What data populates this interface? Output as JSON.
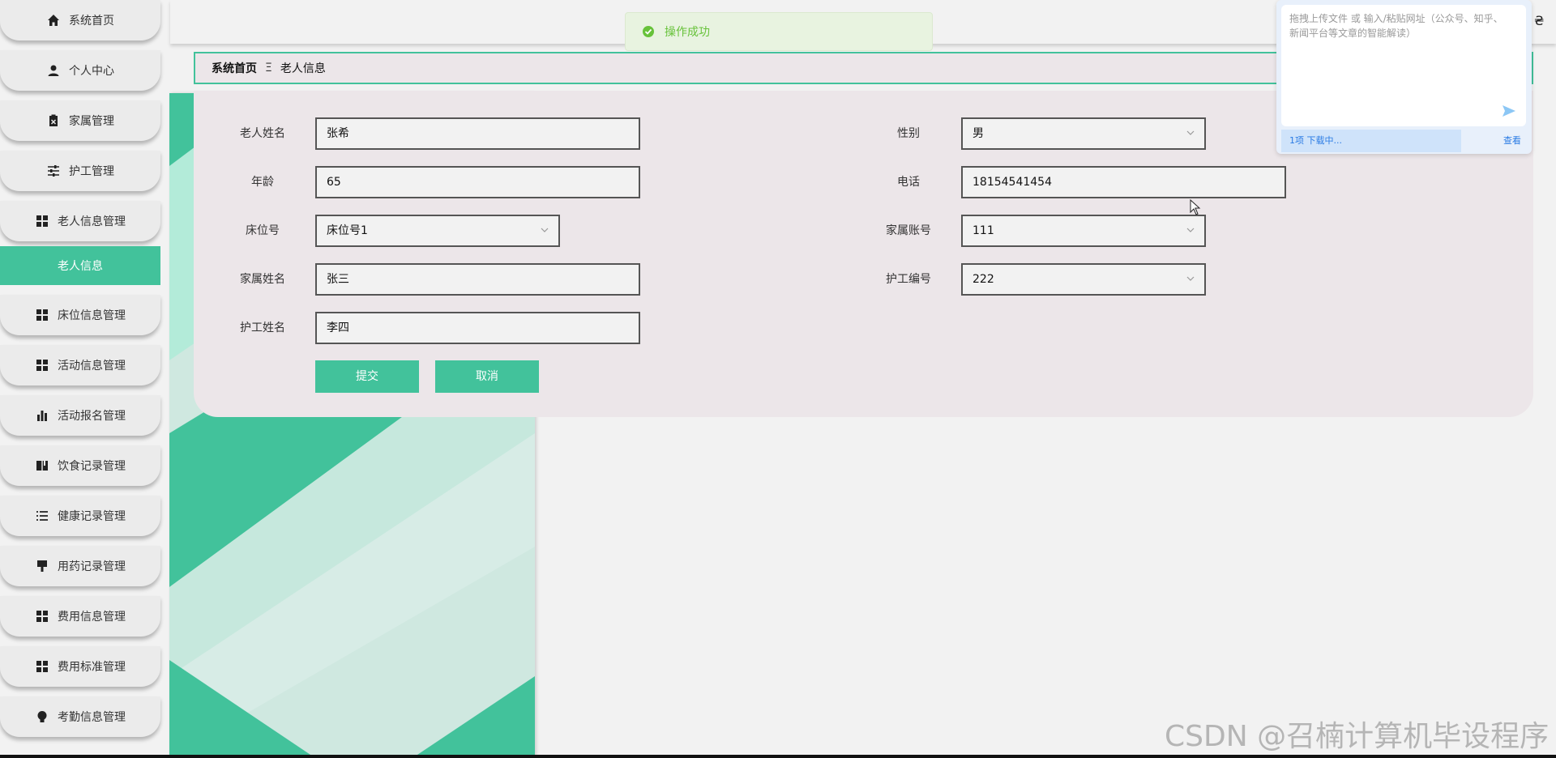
{
  "sidebar": {
    "items": [
      {
        "label": "系统首页",
        "icon": "home-icon"
      },
      {
        "label": "个人中心",
        "icon": "user-icon"
      },
      {
        "label": "家属管理",
        "icon": "clipboard-icon"
      },
      {
        "label": "护工管理",
        "icon": "sliders-icon"
      },
      {
        "label": "老人信息管理",
        "icon": "grid-icon"
      },
      {
        "label": "老人信息",
        "icon": "",
        "active": true
      },
      {
        "label": "床位信息管理",
        "icon": "grid-icon"
      },
      {
        "label": "活动信息管理",
        "icon": "grid-icon"
      },
      {
        "label": "活动报名管理",
        "icon": "bar-chart-icon"
      },
      {
        "label": "饮食记录管理",
        "icon": "book-icon"
      },
      {
        "label": "健康记录管理",
        "icon": "list-icon"
      },
      {
        "label": "用药记录管理",
        "icon": "brush-icon"
      },
      {
        "label": "费用信息管理",
        "icon": "grid-icon"
      },
      {
        "label": "费用标准管理",
        "icon": "grid-icon"
      },
      {
        "label": "考勤信息管理",
        "icon": "bulb-icon"
      }
    ]
  },
  "toast": {
    "message": "操作成功"
  },
  "breadcrumb": {
    "home": "系统首页",
    "separator": "Ξ",
    "current": "老人信息"
  },
  "form": {
    "name_label": "老人姓名",
    "name_value": "张希",
    "gender_label": "性别",
    "gender_value": "男",
    "age_label": "年龄",
    "age_value": "65",
    "phone_label": "电话",
    "phone_value": "18154541454",
    "bed_label": "床位号",
    "bed_value": "床位号1",
    "family_account_label": "家属账号",
    "family_account_value": "111",
    "family_name_label": "家属姓名",
    "family_name_value": "张三",
    "caregiver_no_label": "护工编号",
    "caregiver_no_value": "222",
    "caregiver_name_label": "护工姓名",
    "caregiver_name_value": "李四",
    "submit_label": "提交",
    "cancel_label": "取消"
  },
  "widget": {
    "placeholder": "拖拽上传文件 或 输入/粘贴网址（公众号、知乎、新闻平台等文章的智能解读）",
    "download_status": "1项 下载中...",
    "view_label": "查看"
  },
  "watermark": "CSDN @召楠计算机毕设程序",
  "colors": {
    "accent": "#42c29b",
    "panel": "#ece6e9",
    "toast_text": "#67c23a"
  }
}
